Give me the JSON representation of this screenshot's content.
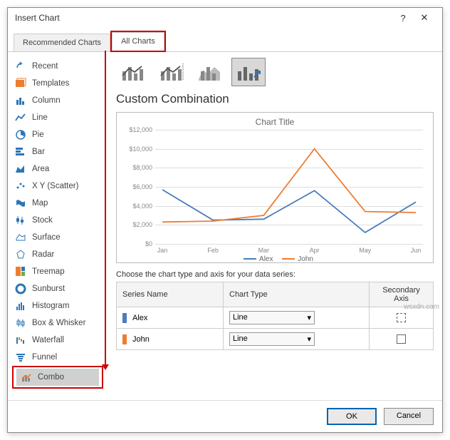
{
  "dialog": {
    "title": "Insert Chart"
  },
  "tabs": {
    "recommended": "Recommended Charts",
    "all": "All Charts"
  },
  "chart_types": [
    {
      "id": "recent",
      "label": "Recent"
    },
    {
      "id": "templates",
      "label": "Templates"
    },
    {
      "id": "column",
      "label": "Column"
    },
    {
      "id": "line",
      "label": "Line"
    },
    {
      "id": "pie",
      "label": "Pie"
    },
    {
      "id": "bar",
      "label": "Bar"
    },
    {
      "id": "area",
      "label": "Area"
    },
    {
      "id": "xy",
      "label": "X Y (Scatter)"
    },
    {
      "id": "map",
      "label": "Map"
    },
    {
      "id": "stock",
      "label": "Stock"
    },
    {
      "id": "surface",
      "label": "Surface"
    },
    {
      "id": "radar",
      "label": "Radar"
    },
    {
      "id": "treemap",
      "label": "Treemap"
    },
    {
      "id": "sunburst",
      "label": "Sunburst"
    },
    {
      "id": "histogram",
      "label": "Histogram"
    },
    {
      "id": "boxwhisker",
      "label": "Box & Whisker"
    },
    {
      "id": "waterfall",
      "label": "Waterfall"
    },
    {
      "id": "funnel",
      "label": "Funnel"
    },
    {
      "id": "combo",
      "label": "Combo"
    }
  ],
  "main": {
    "section_title": "Custom Combination",
    "chart_title": "Chart Title",
    "series_instruction": "Choose the chart type and axis for your data series:",
    "headers": {
      "name": "Series Name",
      "type": "Chart Type",
      "axis": "Secondary Axis"
    },
    "series": [
      {
        "name": "Alex",
        "color": "#4a7ebb",
        "type": "Line",
        "secondary": false
      },
      {
        "name": "John",
        "color": "#ed7d31",
        "type": "Line",
        "secondary": false
      }
    ]
  },
  "chart_data": {
    "type": "line",
    "title": "Chart Title",
    "categories": [
      "Jan",
      "Feb",
      "Mar",
      "Apr",
      "May",
      "Jun"
    ],
    "ylim": [
      0,
      12000
    ],
    "yticks": [
      "$0",
      "$2,000",
      "$4,000",
      "$6,000",
      "$8,000",
      "$10,000",
      "$12,000"
    ],
    "series": [
      {
        "name": "Alex",
        "color": "#4a7ebb",
        "values": [
          5700,
          2500,
          2600,
          5600,
          1200,
          4400
        ]
      },
      {
        "name": "John",
        "color": "#ed7d31",
        "values": [
          2300,
          2400,
          3000,
          10000,
          3400,
          3300
        ]
      }
    ]
  },
  "footer": {
    "ok": "OK",
    "cancel": "Cancel"
  },
  "watermark": "wsxdn.com"
}
